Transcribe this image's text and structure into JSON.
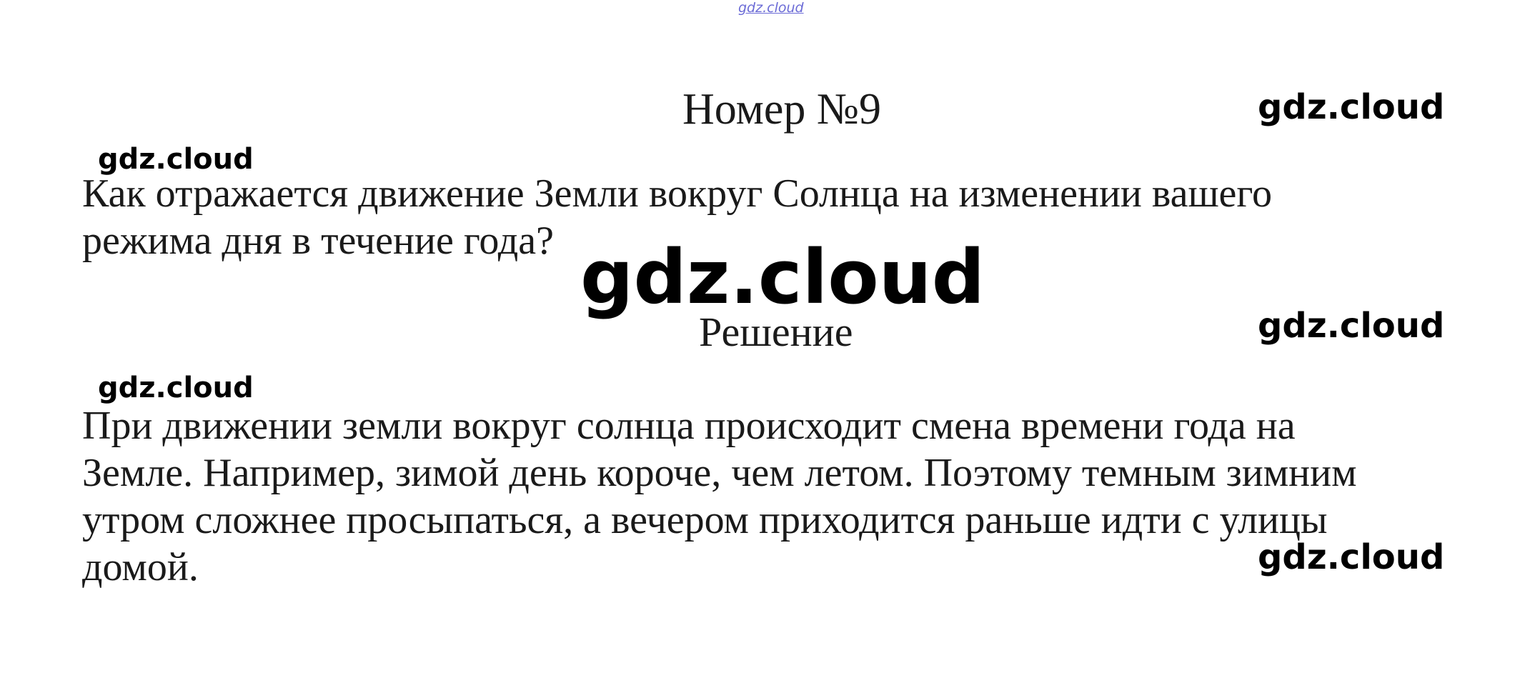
{
  "header": {
    "top_watermark": "gdz.cloud",
    "title": "Номер №9"
  },
  "task": {
    "question_lines": [
      "Как отражается движение Земли вокруг Солнца на изменении вашего",
      "режима дня в течение года?"
    ]
  },
  "solution": {
    "heading": "Решение",
    "answer_lines": [
      "При движении земли вокруг солнца происходит смена времени года на",
      "Земле. Например, зимой день короче, чем летом. Поэтому темным зимним",
      "утром сложнее просыпаться, а вечером приходится раньше идти с улицы",
      "домой."
    ]
  },
  "watermarks": {
    "title_right": "gdz.cloud",
    "question_left": "gdz.cloud",
    "center_large": "gdz.cloud",
    "solution_right": "gdz.cloud",
    "answer_left": "gdz.cloud",
    "answer_right": "gdz.cloud"
  }
}
